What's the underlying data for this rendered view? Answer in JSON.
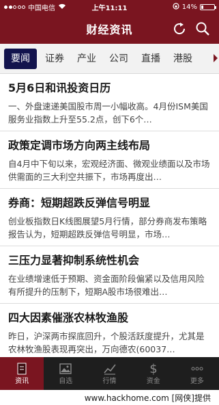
{
  "status_bar": {
    "carrier": "中国电信",
    "time": "上午11:11",
    "battery": "14%",
    "battery_level": 0.14
  },
  "header": {
    "title": "财经资讯",
    "refresh_icon": "refresh-icon",
    "search_icon": "search-icon"
  },
  "tabs": [
    {
      "label": "要闻",
      "active": true
    },
    {
      "label": "证券",
      "active": false
    },
    {
      "label": "产业",
      "active": false
    },
    {
      "label": "公司",
      "active": false
    },
    {
      "label": "直播",
      "active": false
    },
    {
      "label": "港股",
      "active": false
    }
  ],
  "news": [
    {
      "title": "5月6日和讯投资日历",
      "summary": "一、外盘速递美国股市周一小幅收高。4月份ISM美国服务业指数上升至55.2点，创下6个…"
    },
    {
      "title": "政策定调市场方向两主线布局",
      "summary": "自4月中下旬以来，宏观经济面、微观业绩面以及市场供需面的三大利空共振下，市场再度出…"
    },
    {
      "title": "券商：短期超跌反弹信号明显",
      "summary": "创业板指数日K线图展望5月行情，部分券商发布策略报告认为，短期超跌反弹信号明显，市场…"
    },
    {
      "title": "三压力显著抑制系统性机会",
      "summary": "在业绩增速低于预期、资金面阶段偏紧以及信用风险有所提升的压制下，短期A股市场很难出…"
    },
    {
      "title": "四大因素催涨农林牧渔股",
      "summary": "昨日，沪深两市探底回升，个股活跃度提升，尤其是农林牧渔股表现再突出，万向德农(60037…"
    }
  ],
  "bottom_nav": [
    {
      "label": "资讯",
      "icon": "news-icon",
      "active": true
    },
    {
      "label": "自选",
      "icon": "picture-icon",
      "active": false
    },
    {
      "label": "行情",
      "icon": "chart-icon",
      "active": false
    },
    {
      "label": "资金",
      "icon": "dollar-icon",
      "active": false
    },
    {
      "label": "更多",
      "icon": "more-icon",
      "active": false
    }
  ],
  "watermark": "www.hackhome.com [网侠]提供",
  "colors": {
    "brand": "#7a1520",
    "active_tab": "#12134d",
    "nav_bg": "#1e1e1e"
  }
}
